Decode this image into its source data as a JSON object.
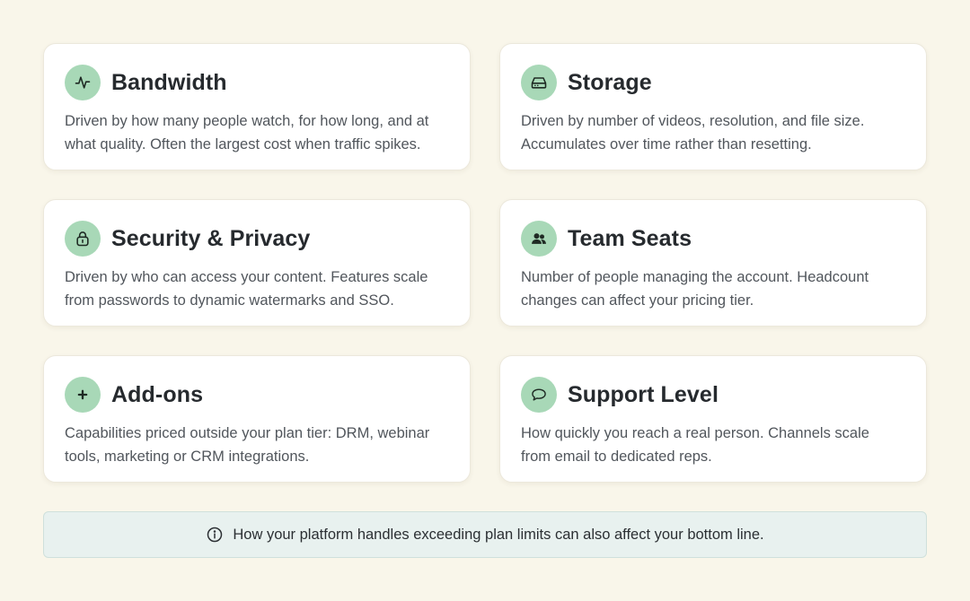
{
  "cards": [
    {
      "icon": "activity-pulse-icon",
      "title": "Bandwidth",
      "description": "Driven by how many people watch, for how long, and at what quality. Often the largest cost when traffic spikes."
    },
    {
      "icon": "hard-drive-icon",
      "title": "Storage",
      "description": "Driven by number of videos, resolution, and file size. Accumulates over time rather than resetting."
    },
    {
      "icon": "lock-icon",
      "title": "Security & Privacy",
      "description": "Driven by who can access your content. Features scale from passwords to dynamic watermarks and SSO."
    },
    {
      "icon": "users-icon",
      "title": "Team Seats",
      "description": "Number of people managing the account. Headcount changes can affect your pricing tier."
    },
    {
      "icon": "plus-icon",
      "title": "Add-ons",
      "description": "Capabilities priced outside your plan tier: DRM, webinar tools, marketing or CRM integrations."
    },
    {
      "icon": "chat-bubble-icon",
      "title": "Support Level",
      "description": "How quickly you reach a real person. Channels scale from email to dedicated reps."
    }
  ],
  "note": {
    "icon": "info-icon",
    "text": "How your platform handles exceeding plan limits can also affect your bottom line."
  },
  "colors": {
    "page_background": "#f9f6ea",
    "card_background": "#ffffff",
    "icon_background": "#a8d8b7",
    "note_background": "#e8f1ef"
  }
}
